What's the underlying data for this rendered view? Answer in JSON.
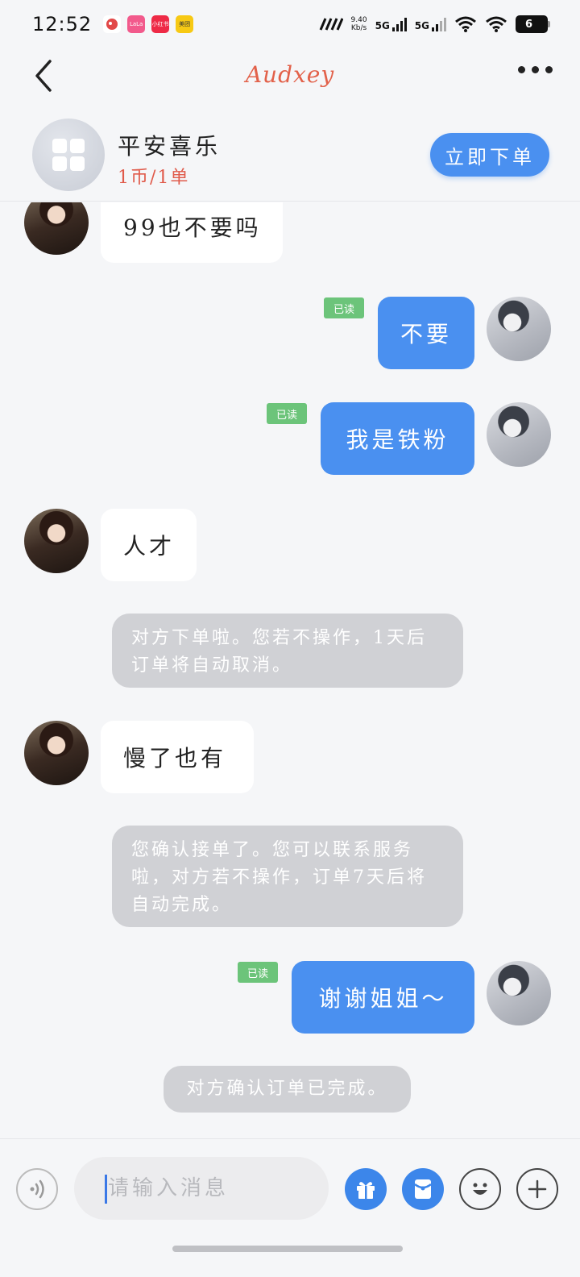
{
  "status_bar": {
    "time": "12:52",
    "apps": [
      {
        "icon": "app-icon-1",
        "label": "",
        "color": "#ffffff"
      },
      {
        "icon": "app-icon-2",
        "label": "LaLa",
        "color": "#f25a8c"
      },
      {
        "icon": "app-icon-3",
        "label": "小红书",
        "color": "#ee2a46"
      },
      {
        "icon": "app-icon-4",
        "label": "美团",
        "color": "#f7c914"
      }
    ],
    "speed_value": "9.40",
    "speed_unit": "Kb/s",
    "net1": "5G",
    "net2": "5G",
    "battery": "6"
  },
  "header": {
    "title": "Audxey"
  },
  "service": {
    "name": "平安喜乐",
    "price": "1币/1单",
    "order_label": "立即下单"
  },
  "messages": [
    {
      "side": "in",
      "text": "99也不要吗"
    },
    {
      "side": "out",
      "text": "不要",
      "status": "已读"
    },
    {
      "side": "out",
      "text": "我是铁粉",
      "status": "已读"
    },
    {
      "side": "in",
      "text": "人才"
    },
    {
      "side": "system",
      "text": "对方下单啦。您若不操作，1天后订单将自动取消。"
    },
    {
      "side": "in",
      "text": "慢了也有"
    },
    {
      "side": "system",
      "text": "您确认接单了。您可以联系服务啦，对方若不操作，订单7天后将自动完成。"
    },
    {
      "side": "out",
      "text": "谢谢姐姐～",
      "status": "已读"
    },
    {
      "side": "system",
      "text": "对方确认订单已完成。"
    }
  ],
  "input": {
    "placeholder": "请输入消息"
  },
  "colors": {
    "accent": "#4a90f0",
    "title": "#e2614a",
    "read": "#6cc47a"
  }
}
